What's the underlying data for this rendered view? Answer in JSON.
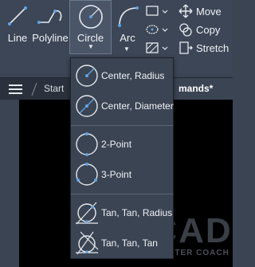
{
  "ribbon": {
    "tools": {
      "line": "Line",
      "polyline": "Polyline",
      "circle": "Circle",
      "arc": "Arc"
    },
    "modify": {
      "move": "Move",
      "copy": "Copy",
      "stretch": "Stretch"
    }
  },
  "tabs": {
    "start": "Start",
    "active": "mands*"
  },
  "circle_menu": {
    "items": [
      "Center, Radius",
      "Center, Diameter",
      "2-Point",
      "3-Point",
      "Tan, Tan, Radius",
      "Tan, Tan, Tan"
    ]
  },
  "watermark": {
    "logo": "CAD",
    "sub": "MASTER COACH"
  },
  "colors": {
    "ribbon_bg": "#3d4656",
    "menu_bg": "#3b4453",
    "icon_blue": "#5fa3e6",
    "canvas": "#000000"
  }
}
